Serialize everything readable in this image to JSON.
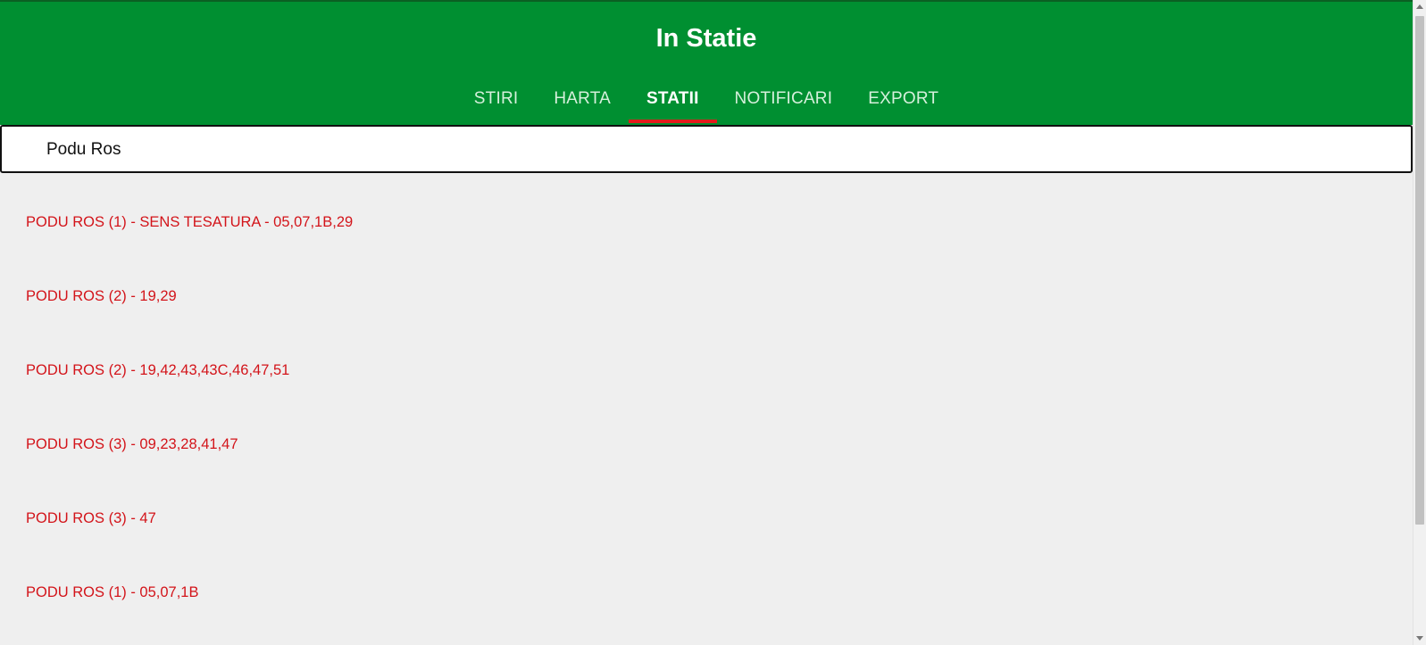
{
  "app": {
    "title": "In Statie"
  },
  "tabs": [
    {
      "label": "STIRI",
      "active": false
    },
    {
      "label": "HARTA",
      "active": false
    },
    {
      "label": "STATII",
      "active": true
    },
    {
      "label": "NOTIFICARI",
      "active": false
    },
    {
      "label": "EXPORT",
      "active": false
    }
  ],
  "search": {
    "value": "Podu Ros",
    "placeholder": ""
  },
  "results": [
    {
      "label": "PODU ROS (1) - SENS TESATURA - 05,07,1B,29"
    },
    {
      "label": "PODU ROS (2) - 19,29"
    },
    {
      "label": "PODU ROS (2) - 19,42,43,43C,46,47,51"
    },
    {
      "label": "PODU ROS (3) - 09,23,28,41,47"
    },
    {
      "label": "PODU ROS (3) - 47"
    },
    {
      "label": "PODU ROS (1) - 05,07,1B"
    }
  ],
  "colors": {
    "header_bg": "#008f31",
    "active_tab_indicator": "#e21b1b",
    "result_text": "#d3141a",
    "page_bg": "#efefef"
  }
}
